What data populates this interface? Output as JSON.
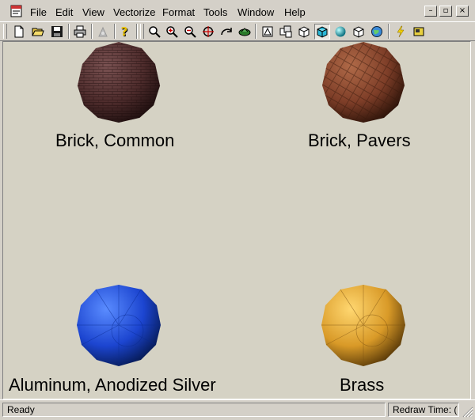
{
  "app": {
    "title_icon": "document-app-icon"
  },
  "menu": {
    "items": [
      "File",
      "Edit",
      "View",
      "Vectorize",
      "Format",
      "Tools",
      "Window",
      "Help"
    ]
  },
  "window_controls": {
    "minimize": "–",
    "restore": "▫",
    "close": "×"
  },
  "toolbar": {
    "buttons": [
      "new-document-icon",
      "open-folder-icon",
      "save-icon",
      "print-icon",
      "disabled-tool-icon",
      "help-icon",
      "zoom-fit-icon",
      "zoom-in-icon",
      "zoom-out-icon",
      "zoom-target-icon",
      "rotate-view-icon",
      "fly-view-icon",
      "wireframe-box-icon",
      "hidden-line-icon",
      "shaded-outline-icon",
      "shaded-box-icon",
      "sphere-icon",
      "cube-icon",
      "globe-icon",
      "lightning-icon",
      "note-icon"
    ]
  },
  "materials": [
    {
      "label": "Brick, Common",
      "color": "#5a3535"
    },
    {
      "label": "Brick, Pavers",
      "color": "#8a4a32"
    },
    {
      "label": "Aluminum, Anodized Silver",
      "color": "#1f4fd6"
    },
    {
      "label": "Brass",
      "color": "#e0a530"
    }
  ],
  "status": {
    "left": "Ready",
    "right": "Redraw Time: ("
  },
  "colors": {
    "canvas": "#d5d2c4",
    "chrome": "#d4d0c8"
  }
}
